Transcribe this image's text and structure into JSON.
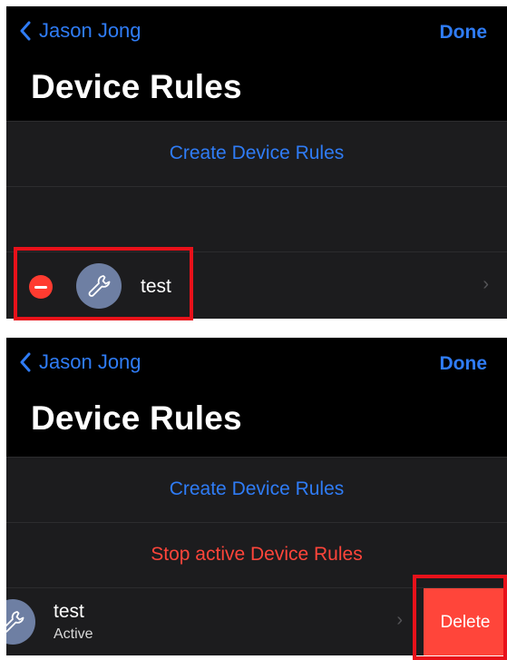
{
  "nav": {
    "back_label": "Jason Jong",
    "done_label": "Done"
  },
  "title": "Device Rules",
  "actions": {
    "create": "Create Device Rules",
    "stop": "Stop active Device Rules"
  },
  "rule": {
    "name": "test",
    "status": "Active"
  },
  "swipe_action": {
    "delete_label": "Delete"
  },
  "colors": {
    "accent": "#2f7cf6",
    "destructive": "#ff453a",
    "highlight": "#e8111a"
  }
}
